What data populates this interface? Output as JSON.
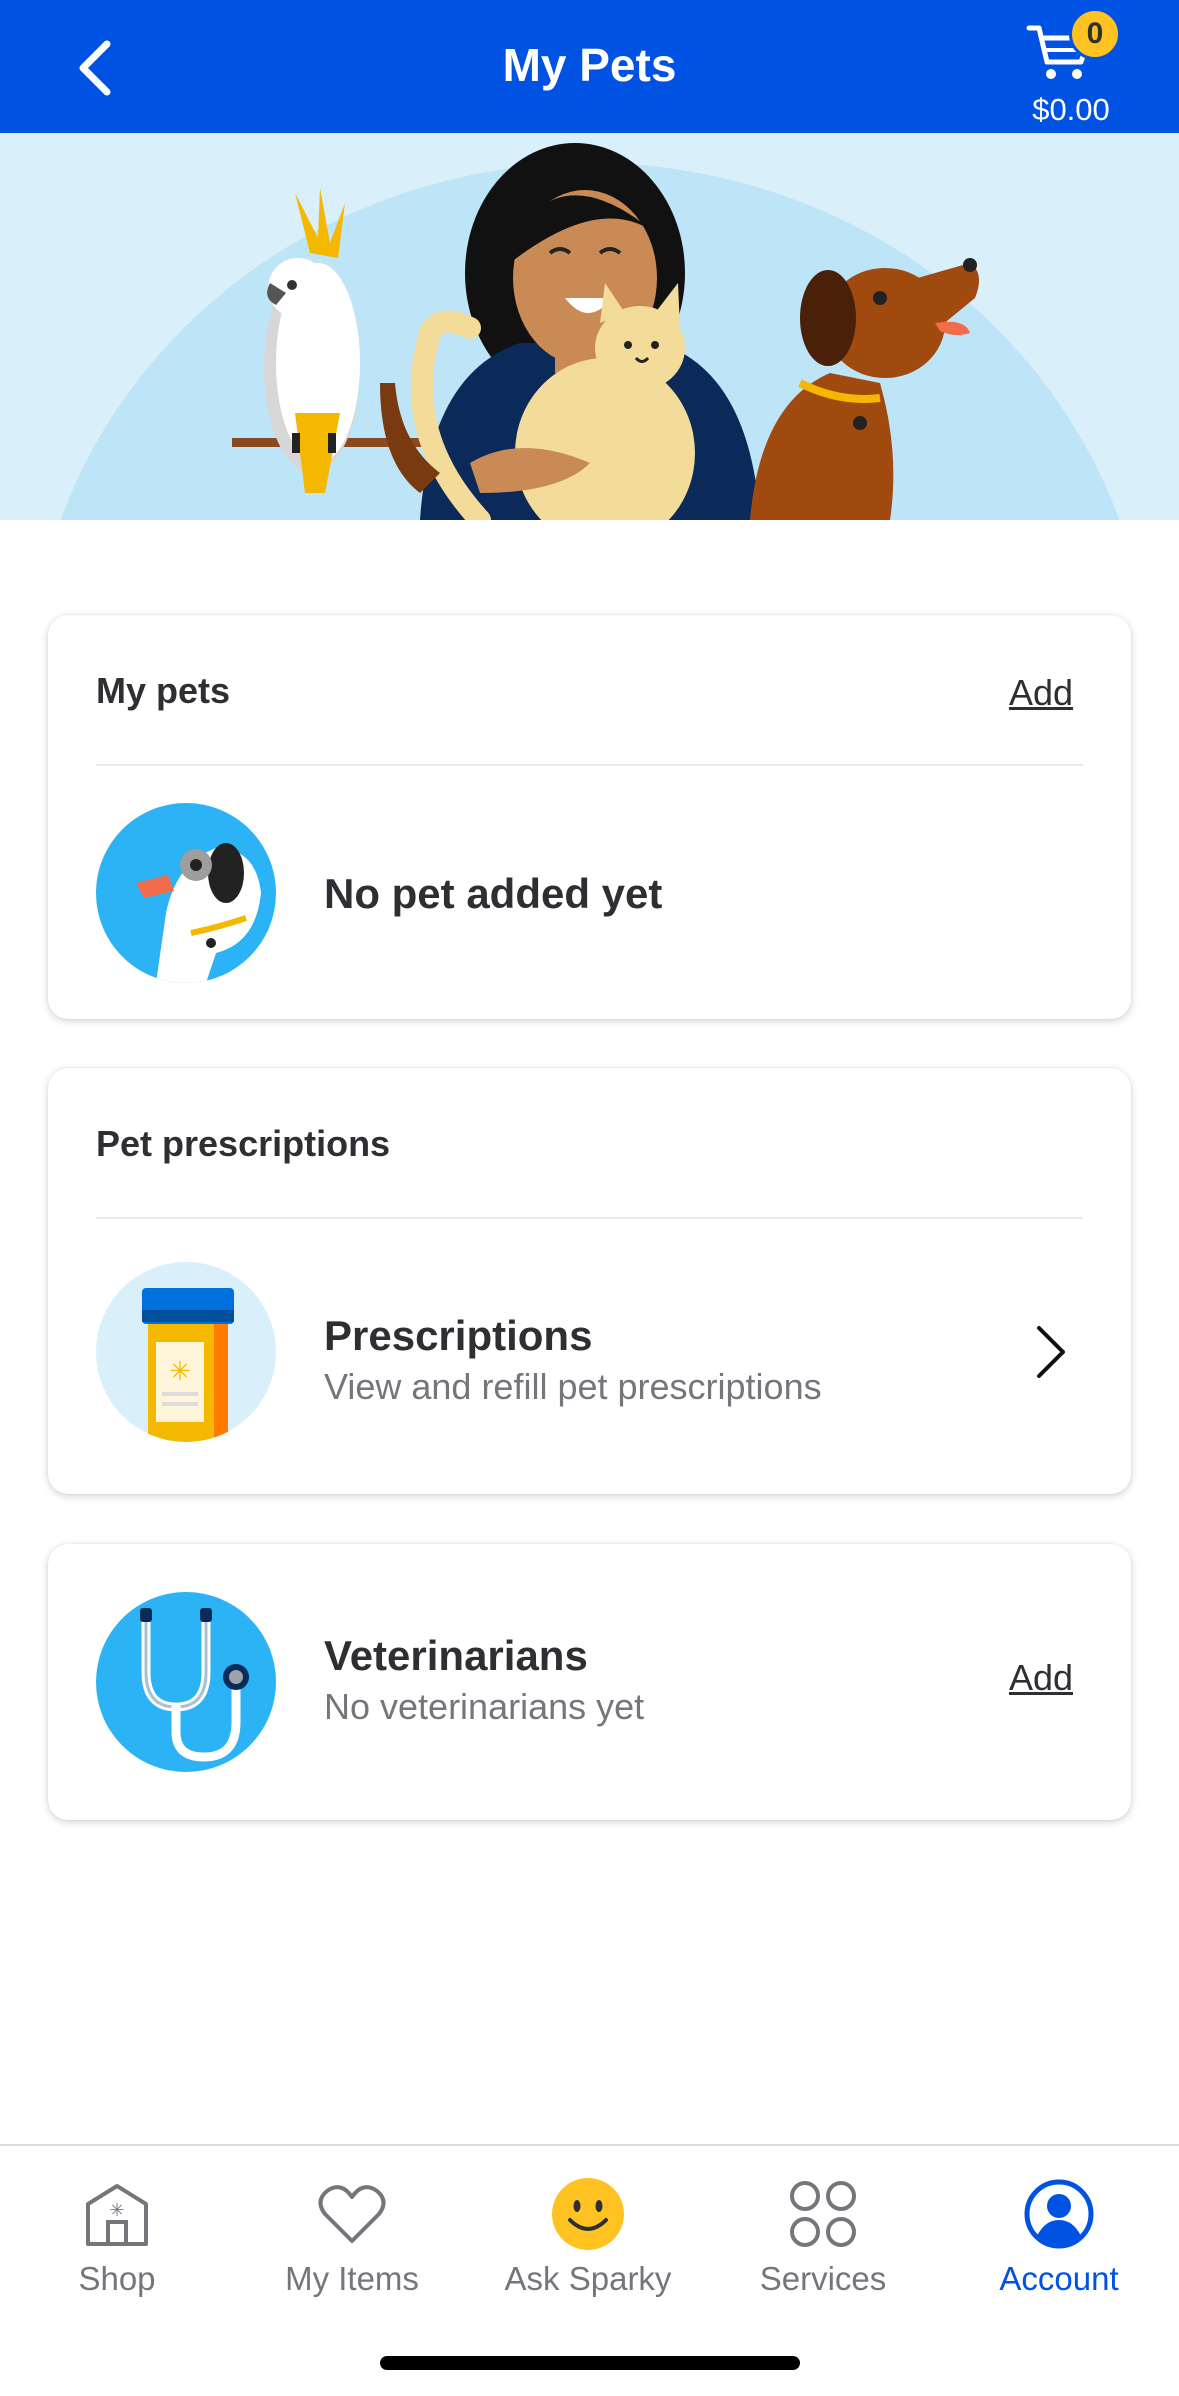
{
  "header": {
    "title": "My Pets",
    "cart_count": "0",
    "cart_total": "$0.00"
  },
  "my_pets_card": {
    "heading": "My pets",
    "add_label": "Add",
    "empty_text": "No pet added yet"
  },
  "prescriptions_card": {
    "heading": "Pet prescriptions",
    "title": "Prescriptions",
    "subtitle": "View and refill pet prescriptions"
  },
  "vets_card": {
    "title": "Veterinarians",
    "subtitle": "No veterinarians yet",
    "add_label": "Add"
  },
  "bottom_nav": {
    "items": [
      {
        "label": "Shop",
        "icon": "store-icon"
      },
      {
        "label": "My Items",
        "icon": "heart-icon"
      },
      {
        "label": "Ask Sparky",
        "icon": "sparky-smiley-icon"
      },
      {
        "label": "Services",
        "icon": "grid-circles-icon"
      },
      {
        "label": "Account",
        "icon": "account-icon",
        "active": true
      }
    ]
  },
  "colors": {
    "brand_blue": "#0053e2",
    "cart_badge": "#ffc220",
    "icon_bg_blue": "#2bb3f5",
    "sparky_yellow": "#ffc220"
  }
}
